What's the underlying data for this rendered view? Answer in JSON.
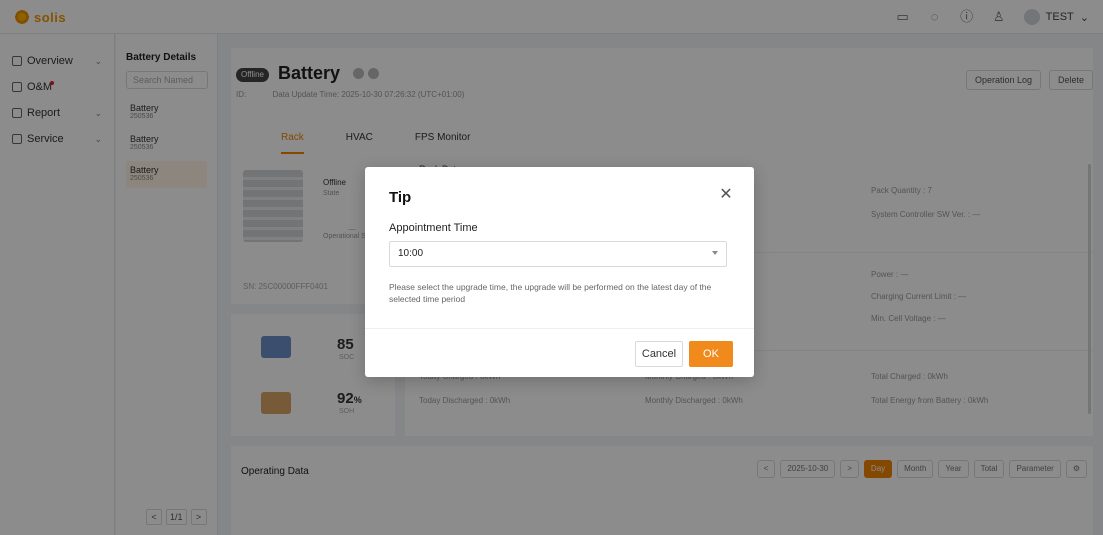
{
  "app": {
    "logo_text": "solis"
  },
  "topbar": {
    "user_name": "TEST"
  },
  "nav": {
    "items": [
      {
        "label": "Overview"
      },
      {
        "label": "O&M"
      },
      {
        "label": "Report"
      },
      {
        "label": "Service"
      }
    ]
  },
  "secondary": {
    "title": "Battery Details",
    "search_placeholder": "Search Named",
    "items": [
      {
        "name": "Battery",
        "sub": "250536"
      },
      {
        "name": "Battery",
        "sub": "250536"
      },
      {
        "name": "Battery",
        "sub": "250536"
      }
    ],
    "pager": {
      "prev": "<",
      "page": "1/1",
      "next": ">"
    }
  },
  "header": {
    "status": "Offline",
    "title": "Battery",
    "id_label": "ID:",
    "data_update": "Data Update Time: 2025-10-30 07:26:32 (UTC+01:00)",
    "operation_log": "Operation Log",
    "delete": "Delete",
    "tabs": [
      "Rack",
      "HVAC",
      "FPS Monitor"
    ]
  },
  "device": {
    "state": "Offline",
    "state_sub": "State",
    "op_dash": "—",
    "op_label": "Operational Status",
    "sn": "SN: 25C00000FFF0401"
  },
  "stats": {
    "soc_value": "85",
    "soc_label": "SOC",
    "soh_value": "92",
    "soh_unit": "%",
    "soh_label": "SOH"
  },
  "data_card": {
    "section_title": "Rack Data",
    "pack_quantity": "Pack Quantity : 7",
    "sys_controller": "System Controller SW Ver. : —",
    "power": "Power : —",
    "charging_limit": "Charging Current Limit : —",
    "min_cell": "Min. Cell Voltage : —",
    "today_charged": "Today Charged : 0kWh",
    "monthly_charged": "Monthly Charged : 0kWh",
    "total_charged": "Total Charged : 0kWh",
    "today_discharged": "Today Discharged : 0kWh",
    "monthly_discharged": "Monthly Discharged : 0kWh",
    "total_from_battery": "Total Energy from Battery : 0kWh"
  },
  "operating": {
    "title": "Operating Data",
    "prev": "<",
    "date": "2025-10-30",
    "next": ">",
    "day": "Day",
    "month": "Month",
    "year": "Year",
    "total": "Total",
    "parameter": "Parameter"
  },
  "modal": {
    "title": "Tip",
    "field_label": "Appointment Time",
    "selected_time": "10:00",
    "hint": "Please select the upgrade time, the upgrade will be performed on the latest day of the selected time period",
    "cancel": "Cancel",
    "ok": "OK"
  },
  "colors": {
    "accent": "#f08a1c",
    "overlay": "rgba(0,0,0,0.45)"
  }
}
